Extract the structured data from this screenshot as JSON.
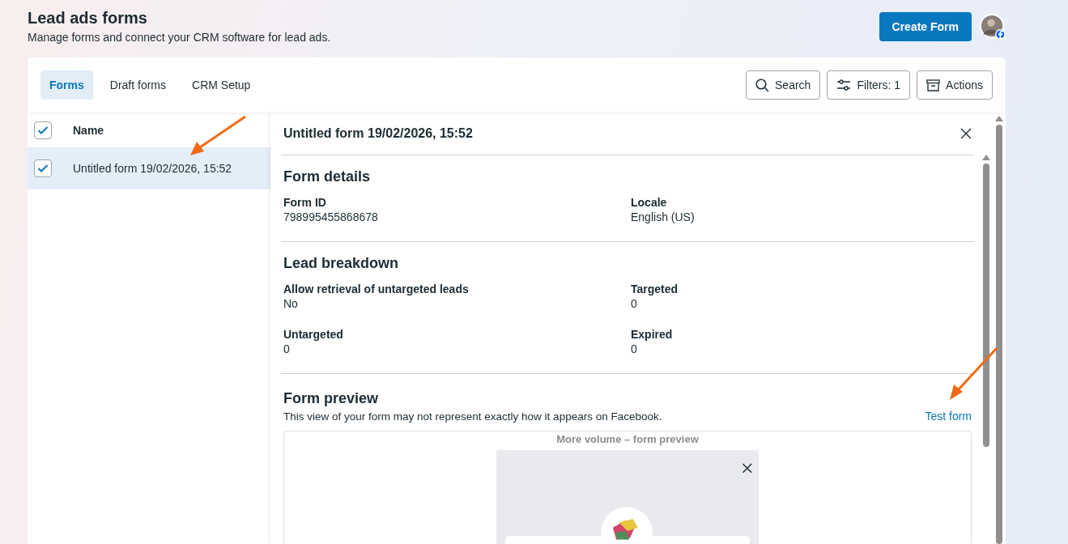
{
  "header": {
    "title": "Lead ads forms",
    "subtitle": "Manage forms and connect your CRM software for lead ads.",
    "create_button": "Create Form"
  },
  "tabs": [
    {
      "label": "Forms",
      "selected": true
    },
    {
      "label": "Draft forms",
      "selected": false
    },
    {
      "label": "CRM Setup",
      "selected": false
    }
  ],
  "toolbar": [
    {
      "kind": "search",
      "label": "Search"
    },
    {
      "kind": "filters",
      "label": "Filters: 1"
    },
    {
      "kind": "actions",
      "label": "Actions"
    }
  ],
  "list": {
    "column": "Name",
    "all_checked": true,
    "rows": [
      {
        "name": "Untitled form 19/02/2026, 15:52",
        "checked": true,
        "selected": true
      }
    ]
  },
  "detail": {
    "title": "Untitled form 19/02/2026, 15:52",
    "sections": [
      {
        "heading": "Form details",
        "fields": [
          {
            "label": "Form ID",
            "value": "798995455868678"
          },
          {
            "label": "Locale",
            "value": "English (US)"
          }
        ]
      },
      {
        "heading": "Lead breakdown",
        "fields": [
          {
            "label": "Allow retrieval of untargeted leads",
            "value": "No"
          },
          {
            "label": "Targeted",
            "value": "0"
          },
          {
            "label": "Untargeted",
            "value": "0"
          },
          {
            "label": "Expired",
            "value": "0"
          }
        ]
      }
    ],
    "preview": {
      "heading": "Form preview",
      "note": "This view of your form may not represent exactly how it appears on Facebook.",
      "link": "Test form",
      "caption": "More volume – form preview"
    }
  }
}
